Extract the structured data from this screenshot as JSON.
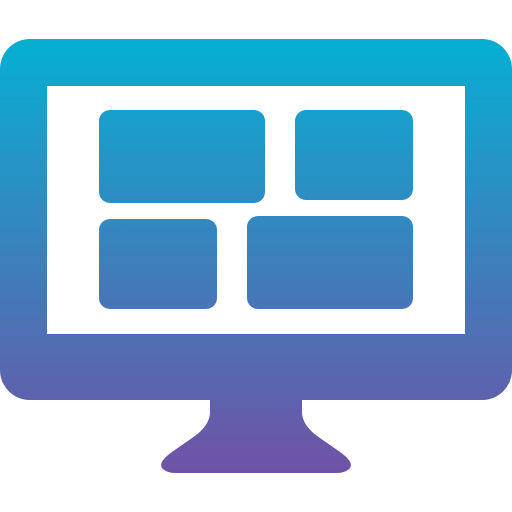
{
  "icon": {
    "name": "desktop-monitor-dashboard-icon",
    "colors": {
      "gradient_top": "#06AFD3",
      "gradient_bottom": "#7052A5",
      "screen_background": "#FFFFFF"
    }
  }
}
